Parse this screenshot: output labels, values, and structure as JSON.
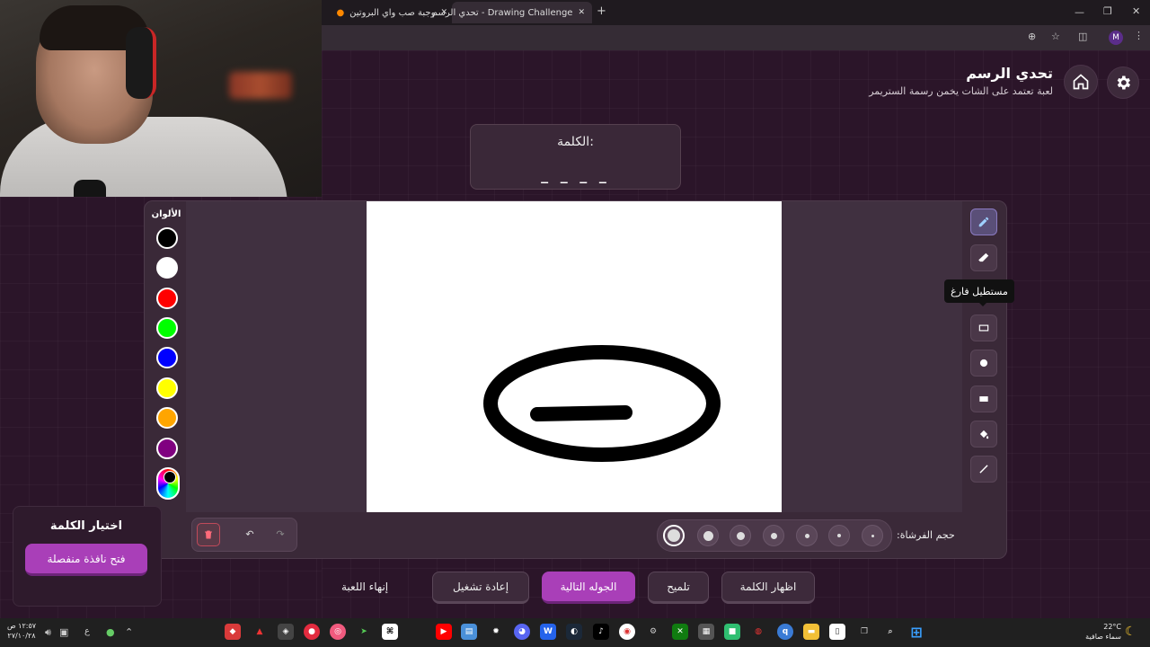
{
  "browser": {
    "tabs": [
      {
        "label": "وجبة صب واي البروتين"
      },
      {
        "label": "Drawing Challenge - تحدي الرسم"
      }
    ],
    "profile_initial": "M"
  },
  "header": {
    "title": "تحدي الرسم",
    "subtitle": "لعبة تعتمد على الشات يخمن رسمة الستريمر"
  },
  "word": {
    "label": "الكلمة:",
    "hint": "_ _ _ _"
  },
  "colors": {
    "title": "الألوان",
    "swatches": [
      "#000000",
      "#ffffff",
      "#ff0000",
      "#00ff00",
      "#0000ff",
      "#ffff00",
      "#ffa500",
      "#800080"
    ]
  },
  "tools": {
    "tooltip": "مستطيل فارغ"
  },
  "brush": {
    "label": "حجم الفرشاة:"
  },
  "buttons": {
    "show_word": "اظهار الكلمة",
    "hint": "تلميح",
    "next_round": "الجوله التالية",
    "restart": "إعادة تشغيل",
    "end_game": "إنهاء اللعبة"
  },
  "word_choice": {
    "title": "اختيار الكلمة",
    "open_window": "فتح نافذة منفصلة"
  },
  "taskbar": {
    "time": "١٢:٥٧ ص",
    "date": "٢٧/١٠/٢٨",
    "lang": "ع",
    "temp": "22°C",
    "weather": "سماء صافية"
  }
}
